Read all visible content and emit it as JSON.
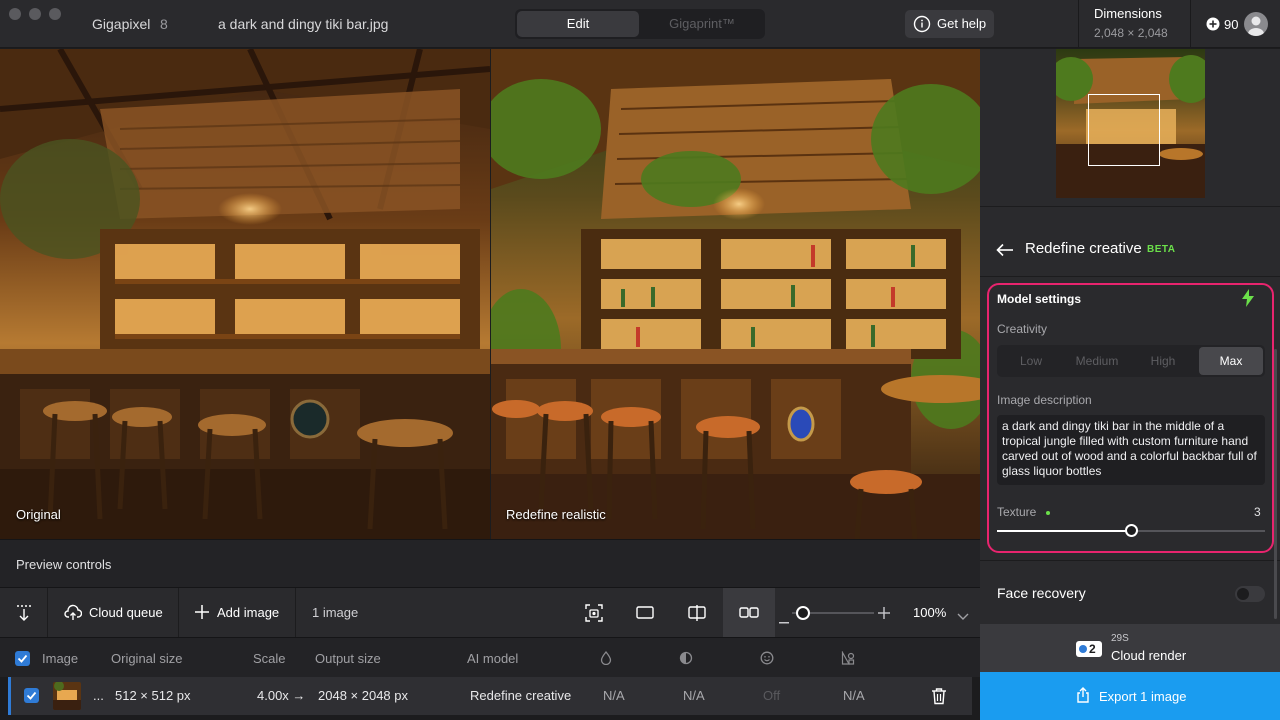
{
  "titlebar": {
    "app_name": "Gigapixel",
    "app_version": "8",
    "file_name": "a dark and dingy tiki bar.jpg",
    "tabs": [
      "Edit",
      "Gigaprint™"
    ],
    "help_label": "Get help",
    "dimensions_title": "Dimensions",
    "dimensions_value": "2,048 × 2,048",
    "credits": "90"
  },
  "images": {
    "left_label": "Original",
    "right_label": "Redefine realistic"
  },
  "preview": {
    "label": "Preview controls"
  },
  "toolbar": {
    "cloud_queue": "Cloud queue",
    "add_image": "Add image",
    "image_count": "1 image",
    "zoom": "100%",
    "zoom_level": 0.08
  },
  "table": {
    "headers": [
      "Image",
      "Original size",
      "Scale",
      "Output size",
      "AI model"
    ],
    "row": {
      "ellipsis": "...",
      "original_size": "512 × 512 px",
      "scale": "4.00x →",
      "output_size": "2048 × 2048 px",
      "model": "Redefine creative",
      "col1": "N/A",
      "col2": "N/A",
      "col3": "Off",
      "col4": "N/A"
    }
  },
  "sidebar": {
    "title": "Redefine creative",
    "beta": "BETA",
    "model_settings": "Model settings",
    "creativity_label": "Creativity",
    "creativity_options": [
      "Low",
      "Medium",
      "High",
      "Max"
    ],
    "creativity_selected": "Max",
    "description_label": "Image description",
    "description": "a dark and dingy tiki bar in the middle of a tropical jungle filled with custom furniture hand carved out of wood and a colorful backbar full of glass liquor bottles",
    "texture_label": "Texture",
    "texture_value": "3",
    "texture_fraction": 0.5,
    "face_recovery": "Face recovery",
    "face_recovery_on": false,
    "cloud_credits": "2",
    "cloud_time": "29S",
    "cloud_render": "Cloud render",
    "export": "Export 1 image"
  },
  "colors": {
    "accent": "#1a9cf0",
    "highlight": "#e8246e",
    "beta": "#6be04a",
    "checkbox": "#2f7bd6"
  }
}
